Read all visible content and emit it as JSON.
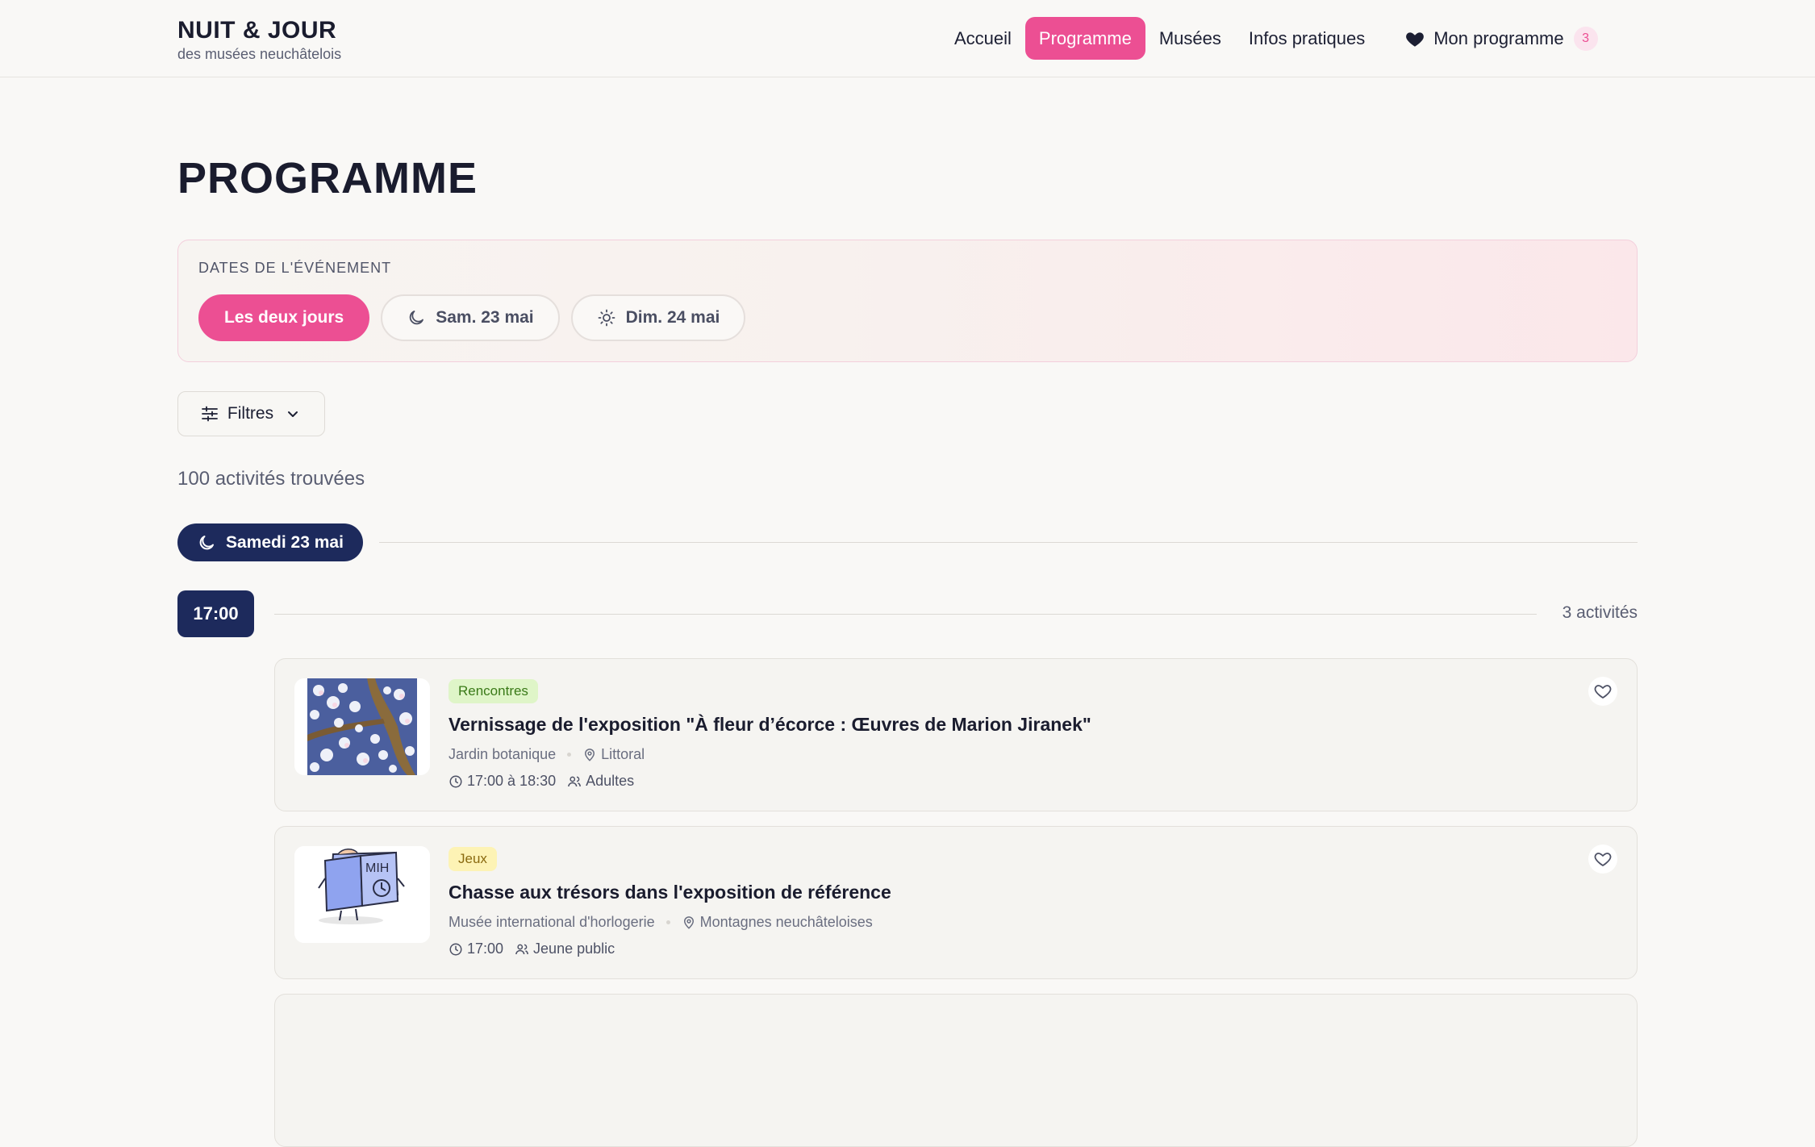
{
  "brand": {
    "title": "NUIT & JOUR",
    "subtitle": "des musées neuchâtelois"
  },
  "nav": {
    "items": [
      "Accueil",
      "Programme",
      "Musées",
      "Infos pratiques"
    ],
    "active": "Programme",
    "favorites_label": "Mon programme",
    "favorites_count": "3"
  },
  "page_title": "PROGRAMME",
  "dates": {
    "label": "DATES DE L'ÉVÉNEMENT",
    "options": [
      "Les deux jours",
      "Sam. 23 mai",
      "Dim. 24 mai"
    ],
    "selected": "Les deux jours"
  },
  "filters_label": "Filtres",
  "results_count": "100 activités trouvées",
  "day": {
    "label": "Samedi 23 mai"
  },
  "time_slot": {
    "time": "17:00",
    "count": "3 activités"
  },
  "activities": [
    {
      "category": "Rencontres",
      "title": "Vernissage de l'exposition \"À fleur d’écorce : Œuvres de Marion Jiranek\"",
      "museum": "Jardin botanique",
      "region": "Littoral",
      "time": "17:00 à 18:30",
      "audience": "Adultes"
    },
    {
      "category": "Jeux",
      "title": "Chasse aux trésors dans l'exposition de référence",
      "museum": "Musée international d'horlogerie",
      "region": "Montagnes neuchâteloises",
      "time": "17:00",
      "audience": "Jeune public"
    }
  ],
  "colors": {
    "accent": "#ec4f93",
    "navy": "#1d2a5c",
    "background": "#f9f8f6"
  }
}
